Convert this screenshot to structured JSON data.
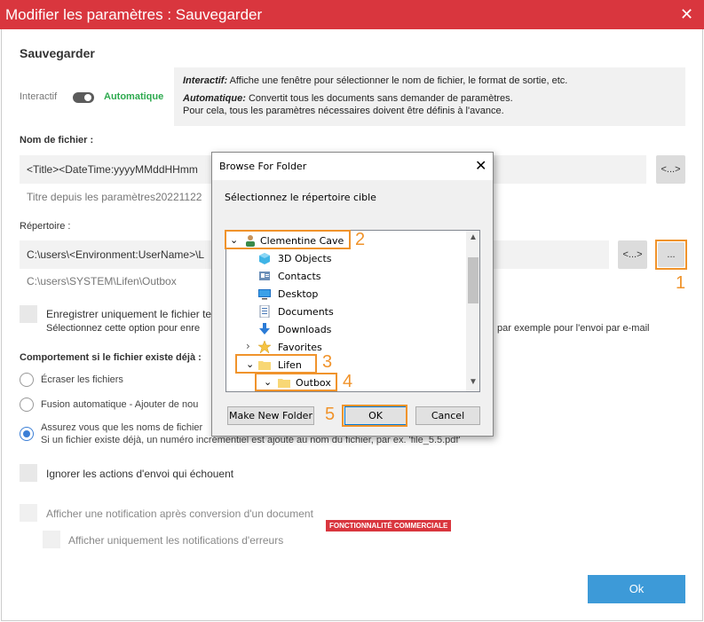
{
  "window": {
    "title": "Modifier les paramètres : Sauvegarder",
    "close_glyph": "✕"
  },
  "header": {
    "section_title": "Sauvegarder"
  },
  "mode": {
    "interactive_label": "Interactif",
    "automatic_label": "Automatique",
    "toggle_state": "automatic",
    "accent_color": "#2eaa4f"
  },
  "info": {
    "interactive_term": "Interactif:",
    "interactive_desc": " Affiche une fenêtre pour sélectionner le nom de fichier, le format de sortie, etc.",
    "automatic_term": "Automatique:",
    "automatic_desc": " Convertit tous les documents sans demander de paramètres.",
    "automatic_desc2": "Pour cela, tous les paramètres nécessaires doivent être définis à l'avance."
  },
  "filename": {
    "label": "Nom de fichier :",
    "value": "<Title><DateTime:yyyyMMddHHmm",
    "preview": "Titre depuis les paramètres20221122",
    "insert_button": "<...>"
  },
  "directory": {
    "label": "Répertoire :",
    "value": "C:\\users\\<Environment:UserName>\\L",
    "preview": "C:\\users\\SYSTEM\\Lifen\\Outbox",
    "insert_button": "<...>",
    "browse_button": "..."
  },
  "save_only_option": {
    "label": "Enregistrer uniquement le fichier te",
    "desc_left": "Sélectionnez cette option pour enre",
    "desc_right": "par exemple pour l'envoi par e-mail"
  },
  "exists_behavior": {
    "label": "Comportement si le fichier existe déjà :",
    "options": [
      {
        "label": "Écraser les fichiers",
        "selected": false
      },
      {
        "label": "Fusion automatique - Ajouter de nou",
        "selected": false
      },
      {
        "label": "Assurez vous que les noms de fichier",
        "desc": "Si un fichier existe déjà, un numéro incrémentiel est ajouté au nom du fichier, par ex. 'file_5.5.pdf'",
        "selected": true
      }
    ]
  },
  "ignore_failed": {
    "label": "Ignorer les actions d'envoi qui échouent"
  },
  "notifications": {
    "label": "Afficher une notification après conversion d'un document",
    "errors_only_label": "Afficher uniquement les notifications d'erreurs",
    "badge": "FONCTIONNALITÉ COMMERCIALE"
  },
  "ok_button": "Ok",
  "dialog": {
    "title": "Browse For Folder",
    "close_glyph": "✕",
    "instruction": "Sélectionnez le répertoire cible",
    "tree": [
      {
        "label": "Clementine Cave",
        "icon": "user-folder-icon",
        "expander": "⌄"
      },
      {
        "label": "3D Objects",
        "icon": "3d-objects-icon",
        "expander": ""
      },
      {
        "label": "Contacts",
        "icon": "contacts-icon",
        "expander": ""
      },
      {
        "label": "Desktop",
        "icon": "desktop-icon",
        "expander": ""
      },
      {
        "label": "Documents",
        "icon": "documents-icon",
        "expander": ""
      },
      {
        "label": "Downloads",
        "icon": "downloads-icon",
        "expander": ""
      },
      {
        "label": "Favorites",
        "icon": "star-icon",
        "expander": "›"
      },
      {
        "label": "Lifen",
        "icon": "folder-icon",
        "expander": "⌄"
      },
      {
        "label": "Outbox",
        "icon": "folder-icon",
        "expander": "⌄"
      }
    ],
    "make_new_folder": "Make New Folder",
    "ok": "OK",
    "cancel": "Cancel"
  },
  "annotations": {
    "color": "#f0932b",
    "numbers": [
      "1",
      "2",
      "3",
      "4",
      "5"
    ]
  }
}
